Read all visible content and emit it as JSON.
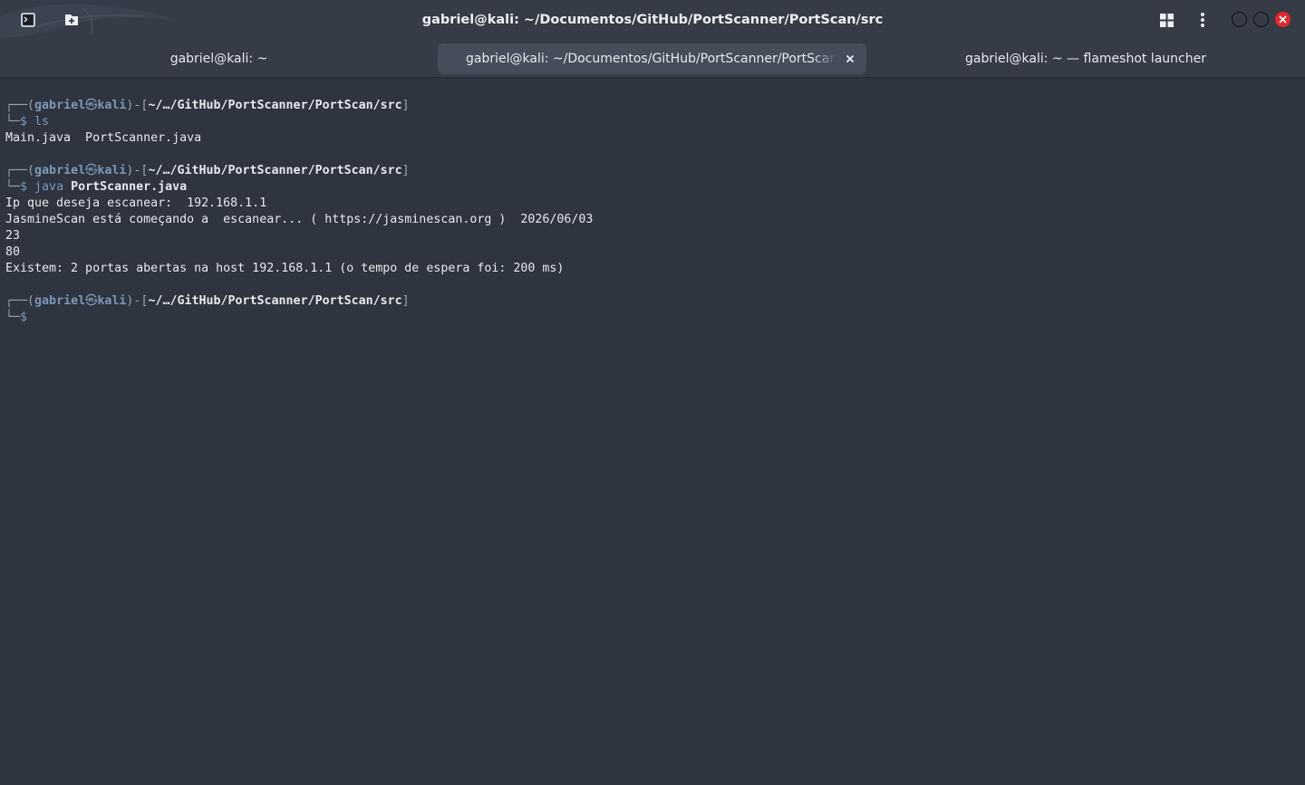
{
  "window": {
    "title": "gabriel@kali: ~/Documentos/GitHub/PortScanner/PortScan/src"
  },
  "tabs": [
    {
      "label": "gabriel@kali: ~",
      "active": false
    },
    {
      "label": "gabriel@kali: ~/Documentos/GitHub/PortScanner/PortScan/src",
      "active": true
    },
    {
      "label": "gabriel@kali: ~ — flameshot launcher",
      "active": false
    }
  ],
  "prompt": {
    "corner_top": "┌──",
    "open_paren": "(",
    "user": "gabriel",
    "at_symbol": "㉿",
    "host": "kali",
    "close_paren_dash": ")-[",
    "path": "~/…/GitHub/PortScanner/PortScan/src",
    "close_bracket": "]",
    "corner_bottom": "└─",
    "dollar": "$"
  },
  "session": [
    {
      "command": "ls",
      "args": "",
      "output": [
        "Main.java  PortScanner.java"
      ]
    },
    {
      "command": "java",
      "args": "PortScanner.java",
      "output": [
        "Ip que deseja escanear:  192.168.1.1",
        "JasmineScan está começando a  escanear... ( https://jasminescan.org )  2026/06/03",
        "23",
        "80",
        "Existem: 2 portas abertas na host 192.168.1.1 (o tempo de espera foi: 200 ms)"
      ]
    }
  ],
  "icons": {
    "terminal": "terminal-icon",
    "new_tab": "new-tab-icon",
    "layout": "grid-icon",
    "menu": "kebab-menu-icon",
    "minimize": "minimize-icon",
    "maximize": "maximize-icon",
    "close": "close-icon"
  },
  "colors": {
    "background": "#2e3440",
    "titlebar": "#353c48",
    "active_tab": "#464d5a",
    "prompt_user": "#7e97b5",
    "close_button": "#e5262b"
  }
}
